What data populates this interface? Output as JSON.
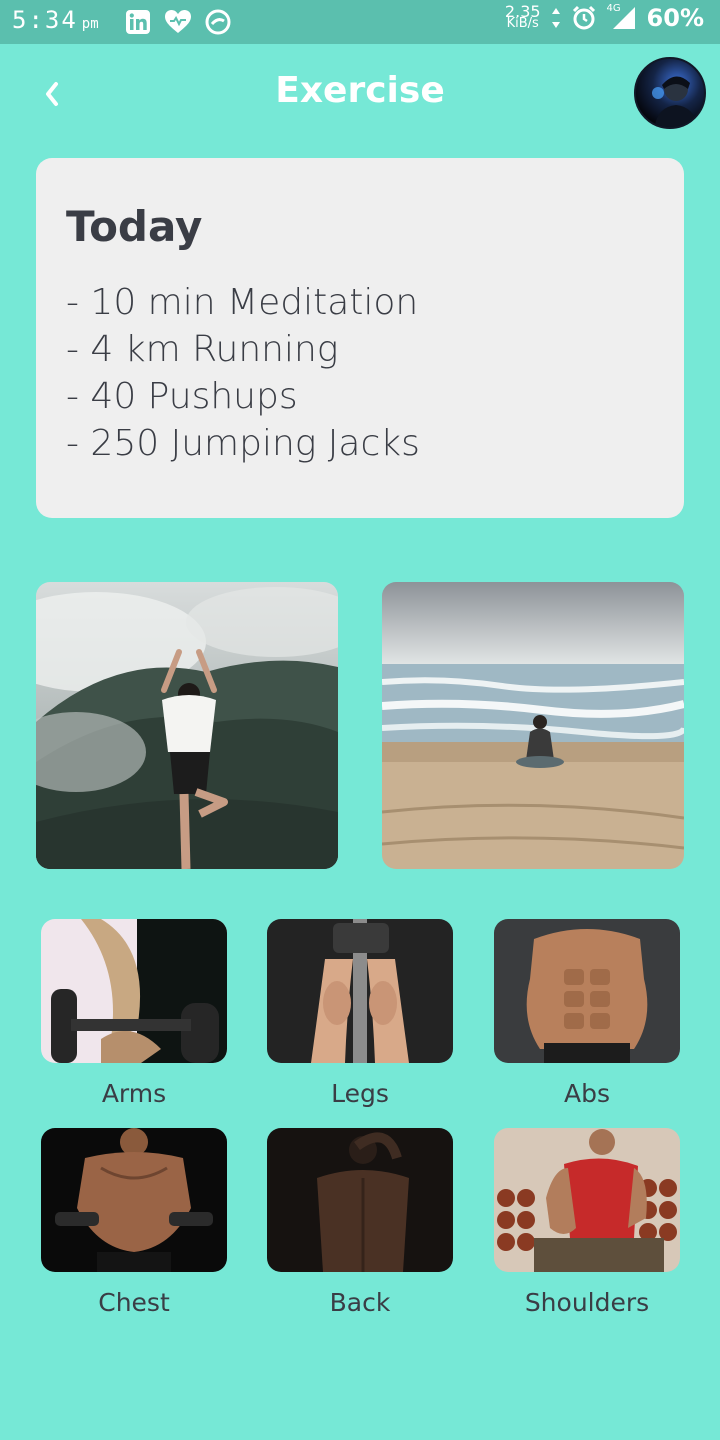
{
  "status_bar": {
    "time": "5:34",
    "ampm": "pm",
    "speed_value": "2.35",
    "speed_unit": "KiB/s",
    "network": "4G",
    "battery": "60%"
  },
  "header": {
    "title": "Exercise",
    "back_icon": "chevron-left-icon",
    "avatar": "profile-avatar"
  },
  "today": {
    "title": "Today",
    "items": [
      "- 10 min Meditation",
      "- 4 km Running",
      "- 40 Pushups",
      "- 250 Jumping Jacks"
    ]
  },
  "features": [
    {
      "name": "mountain-yoga-photo"
    },
    {
      "name": "beach-meditation-photo"
    }
  ],
  "body_parts": [
    {
      "label": "Arms"
    },
    {
      "label": "Legs"
    },
    {
      "label": "Abs"
    },
    {
      "label": "Chest"
    },
    {
      "label": "Back"
    },
    {
      "label": "Shoulders"
    }
  ],
  "colors": {
    "background": "#76E8D6",
    "status_bar": "#5BBFAE",
    "card": "#EFEFEF",
    "text": "#3A3D45"
  }
}
